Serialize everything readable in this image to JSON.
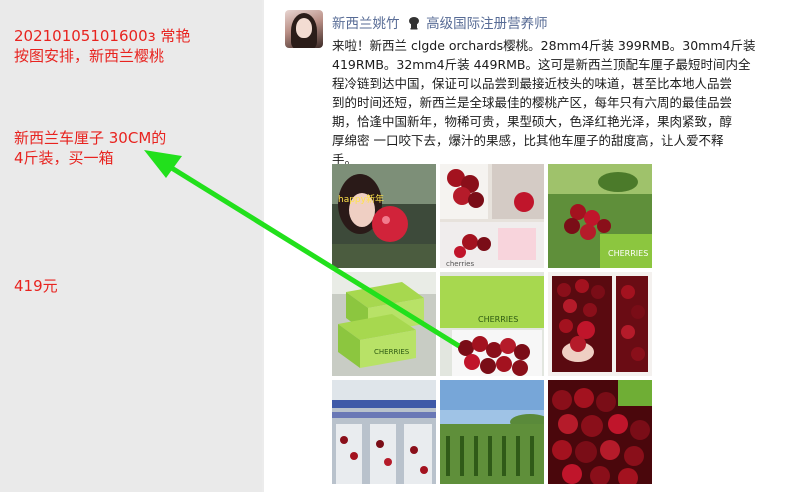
{
  "left_notes": {
    "note1_line1": "20210105101600з    常艳",
    "note1_line2": "按图安排，新西兰樱桃",
    "note2_line1": "新西兰车厘子 30CM的",
    "note2_line2": "4斤装，买一箱",
    "note3": "419元"
  },
  "post": {
    "user_name": "新西兰姚竹",
    "badge_icon": "chef-hat-icon",
    "title": "高级国际注册营养师",
    "text_lines": [
      "来啦！新西兰 clgde orchards樱桃。28mm4斤装 399RMB。30mm4斤装",
      "419RMB。32mm4斤装 449RMB。这可是新西兰顶配车厘子最短时间内全",
      "程冷链到达中国，保证可以品尝到最接近枝头的味道，甚至比本地人品尝",
      "到的时间还短，新西兰是全球最佳的樱桃产区，每年只有六周的最佳品尝",
      "期，恰逢中国新年，物稀可贵，果型硕大，色泽红艳光泽，果肉紧致，醇",
      "厚绵密 一口咬下去，爆汁的果感，比其他车厘子的甜度高，让人爱不释",
      "手。"
    ],
    "photos": [
      {
        "name": "photo-woman-with-cherry",
        "caption": "happy新年"
      },
      {
        "name": "photo-cherry-box-handheld",
        "caption": "cherries"
      },
      {
        "name": "photo-cherries-on-tree",
        "caption": "CHERRIES"
      },
      {
        "name": "photo-green-boxes-stack",
        "caption": "CHERRIES"
      },
      {
        "name": "photo-green-box-open",
        "caption": "CHERRIES"
      },
      {
        "name": "photo-cherry-trays",
        "caption": ""
      },
      {
        "name": "photo-packing-facility",
        "caption": ""
      },
      {
        "name": "photo-orchard-landscape",
        "caption": ""
      },
      {
        "name": "photo-cherry-closeup",
        "caption": ""
      }
    ]
  },
  "colors": {
    "note_red": "#e8231f",
    "arrow_green": "#22e01c",
    "link_blue": "#576b95",
    "cherry": "#7a0d17",
    "box_green": "#8cc63f"
  }
}
